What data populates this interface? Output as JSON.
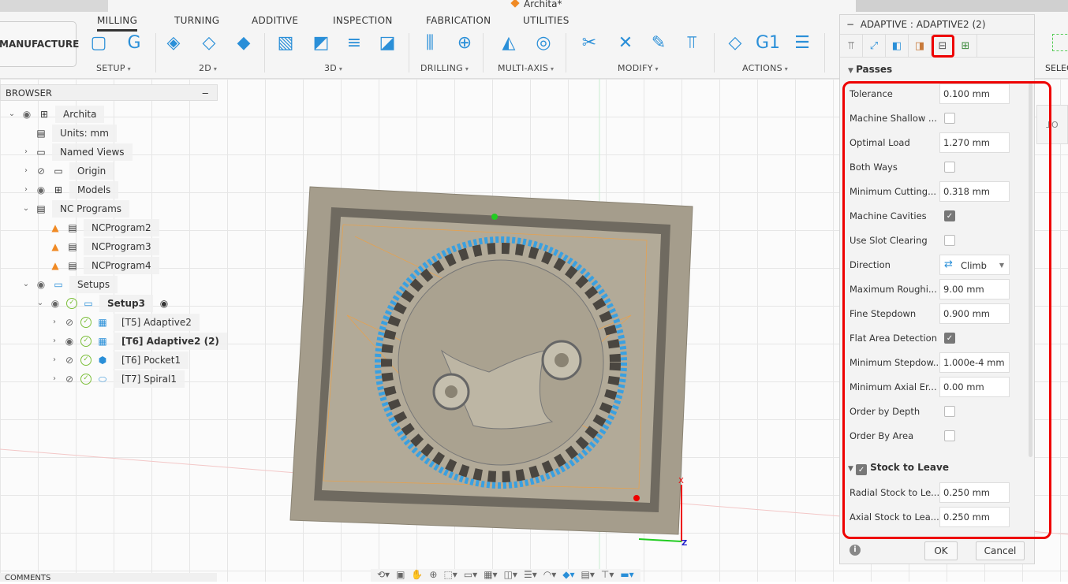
{
  "app": {
    "title": "Archita*",
    "workspace": "MANUFACTURE"
  },
  "tabs": [
    {
      "label": "MILLING",
      "active": true
    },
    {
      "label": "TURNING"
    },
    {
      "label": "ADDITIVE"
    },
    {
      "label": "INSPECTION"
    },
    {
      "label": "FABRICATION"
    },
    {
      "label": "UTILITIES"
    }
  ],
  "groups": [
    "SETUP",
    "2D",
    "3D",
    "DRILLING",
    "MULTI-AXIS",
    "MODIFY",
    "ACTIONS",
    "SELEC"
  ],
  "browser": {
    "title": "BROWSER",
    "collapse": "−",
    "items": [
      {
        "label": "Archita",
        "chev": "⌄",
        "icon": "component",
        "eye": "visible",
        "indent": 0
      },
      {
        "label": "Units: mm",
        "icon": "units",
        "indent": 1
      },
      {
        "label": "Named Views",
        "chev": "›",
        "icon": "folder",
        "indent": 1
      },
      {
        "label": "Origin",
        "chev": "›",
        "icon": "folder",
        "eye": "hidden",
        "indent": 1
      },
      {
        "label": "Models",
        "chev": "›",
        "icon": "component",
        "eye": "visible",
        "indent": 1
      },
      {
        "label": "NC Programs",
        "chev": "⌄",
        "icon": "nc-program",
        "indent": 1
      },
      {
        "label": "NCProgram2",
        "icon": "nc-program",
        "warning": true,
        "indent": 2
      },
      {
        "label": "NCProgram3",
        "icon": "nc-program",
        "warning": true,
        "indent": 2
      },
      {
        "label": "NCProgram4",
        "icon": "nc-program",
        "warning": true,
        "indent": 2
      },
      {
        "label": "Setups",
        "chev": "⌄",
        "icon": "setup-folder",
        "eye": "visible",
        "indent": 1
      },
      {
        "label": "Setup3",
        "chev": "⌄",
        "icon": "setup-folder",
        "eye": "visible",
        "ok": true,
        "bold": true,
        "active": true,
        "indent": 2
      },
      {
        "label": "[T5] Adaptive2",
        "chev": "›",
        "icon": "adaptive",
        "eye": "hidden",
        "ok": true,
        "indent": 3
      },
      {
        "label": "[T6] Adaptive2 (2)",
        "chev": "›",
        "icon": "adaptive",
        "eye": "visible",
        "ok": true,
        "bold": true,
        "indent": 3
      },
      {
        "label": "[T6] Pocket1",
        "chev": "›",
        "icon": "pocket",
        "eye": "hidden",
        "ok": true,
        "indent": 3
      },
      {
        "label": "[T7] Spiral1",
        "chev": "›",
        "icon": "spiral",
        "eye": "hidden",
        "ok": true,
        "indent": 3
      }
    ]
  },
  "comments": "COMMENTS",
  "dialog": {
    "title": "ADAPTIVE : ADAPTIVE2 (2)",
    "tabs": [
      "tool",
      "geometry",
      "heights",
      "stock",
      "passes",
      "linking"
    ],
    "selected_tab": "passes",
    "passes_header": "Passes",
    "fields": [
      {
        "label": "Tolerance",
        "type": "text",
        "value": "0.100 mm"
      },
      {
        "label": "Machine Shallow ...",
        "type": "check",
        "checked": false
      },
      {
        "label": "Optimal Load",
        "type": "text",
        "value": "1.270 mm"
      },
      {
        "label": "Both Ways",
        "type": "check",
        "checked": false
      },
      {
        "label": "Minimum Cutting...",
        "type": "text",
        "value": "0.318 mm"
      },
      {
        "label": "Machine Cavities",
        "type": "check",
        "checked": true
      },
      {
        "label": "Use Slot Clearing",
        "type": "check",
        "checked": false
      },
      {
        "label": "Direction",
        "type": "select",
        "value": "Climb"
      },
      {
        "label": "Maximum Roughi...",
        "type": "text",
        "value": "9.00 mm"
      },
      {
        "label": "Fine Stepdown",
        "type": "text",
        "value": "0.900 mm"
      },
      {
        "label": "Flat Area Detection",
        "type": "check",
        "checked": true
      },
      {
        "label": "Minimum Stepdow...",
        "type": "text",
        "value": "1.000e-4 mm"
      },
      {
        "label": "Minimum Axial Er...",
        "type": "text",
        "value": "0.00 mm"
      },
      {
        "label": "Order by Depth",
        "type": "check",
        "checked": false
      },
      {
        "label": "Order By Area",
        "type": "check",
        "checked": false
      }
    ],
    "stock_header": "Stock to Leave",
    "stock_checked": true,
    "stock_fields": [
      {
        "label": "Radial Stock to Le...",
        "value": "0.250 mm"
      },
      {
        "label": "Axial Stock to Lea...",
        "value": "0.250 mm"
      }
    ],
    "ok": "OK",
    "cancel": "Cancel"
  },
  "side_tab": "TO",
  "axis": {
    "x": "X",
    "z": "Z"
  },
  "colors": {
    "highlight": "#e00000",
    "accent": "#2a8fd8",
    "warning": "#f08a24",
    "ok": "#7cbf3a"
  }
}
